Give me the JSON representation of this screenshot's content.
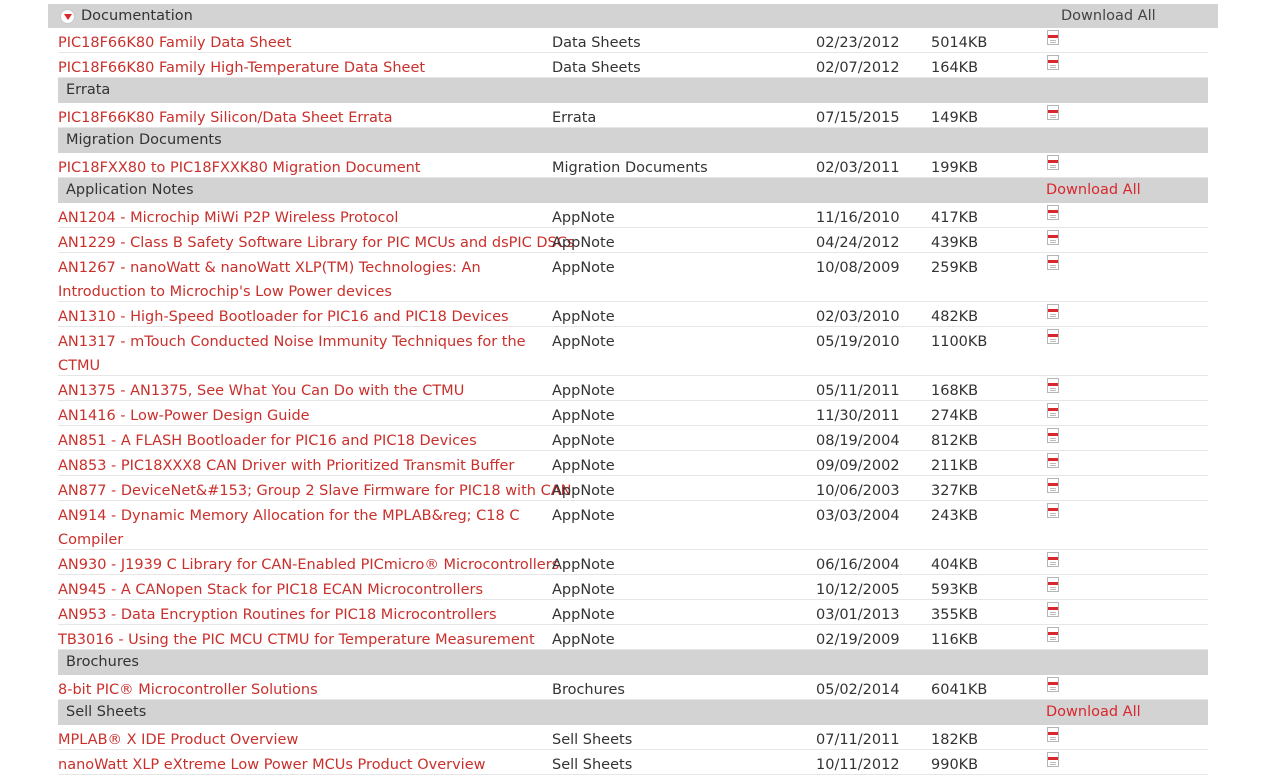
{
  "header": {
    "title": "Documentation",
    "download_all": "Download All"
  },
  "colors": {
    "link": "#c9302c",
    "accent": "#d9272e",
    "category_bg": "#d3d3d3"
  },
  "icons": {
    "row_file": "pdf-icon",
    "header_toggle": "collapse-arrow-icon"
  },
  "sections": [
    {
      "label": "",
      "download_all": "",
      "items": [
        {
          "name": "PIC18F66K80 Family Data Sheet",
          "type": "Data Sheets",
          "date": "02/23/2012",
          "size": "5014KB",
          "tall": false
        },
        {
          "name": "PIC18F66K80 Family High-Temperature Data Sheet",
          "type": "Data Sheets",
          "date": "02/07/2012",
          "size": "164KB",
          "tall": false
        }
      ]
    },
    {
      "label": "Errata",
      "download_all": "",
      "items": [
        {
          "name": "PIC18F66K80 Family Silicon/Data Sheet Errata",
          "type": "Errata",
          "date": "07/15/2015",
          "size": "149KB",
          "tall": false
        }
      ]
    },
    {
      "label": "Migration Documents",
      "download_all": "",
      "items": [
        {
          "name": "PIC18FXX80 to PIC18FXXK80 Migration Document",
          "type": "Migration Documents",
          "date": "02/03/2011",
          "size": "199KB",
          "tall": false
        }
      ]
    },
    {
      "label": "Application Notes",
      "download_all": "Download All",
      "items": [
        {
          "name": "AN1204 - Microchip MiWi P2P Wireless Protocol",
          "type": "AppNote",
          "date": "11/16/2010",
          "size": "417KB",
          "tall": false
        },
        {
          "name": "AN1229 - Class B Safety Software Library for PIC MCUs and dsPIC DSCs",
          "type": "AppNote",
          "date": "04/24/2012",
          "size": "439KB",
          "tall": false
        },
        {
          "name": "AN1267 - nanoWatt & nanoWatt XLP(TM) Technologies: An Introduction to Microchip's Low Power devices",
          "type": "AppNote",
          "date": "10/08/2009",
          "size": "259KB",
          "tall": true
        },
        {
          "name": "AN1310 - High-Speed Bootloader for PIC16 and PIC18 Devices",
          "type": "AppNote",
          "date": "02/03/2010",
          "size": "482KB",
          "tall": false
        },
        {
          "name": "AN1317 - mTouch Conducted Noise Immunity Techniques for the CTMU",
          "type": "AppNote",
          "date": "05/19/2010",
          "size": "1100KB",
          "tall": true
        },
        {
          "name": "AN1375 - AN1375, See What You Can Do with the CTMU",
          "type": "AppNote",
          "date": "05/11/2011",
          "size": "168KB",
          "tall": false
        },
        {
          "name": "AN1416 - Low-Power Design Guide",
          "type": "AppNote",
          "date": "11/30/2011",
          "size": "274KB",
          "tall": false
        },
        {
          "name": "AN851 - A FLASH Bootloader for PIC16 and PIC18 Devices",
          "type": "AppNote",
          "date": "08/19/2004",
          "size": "812KB",
          "tall": false
        },
        {
          "name": "AN853 - PIC18XXX8 CAN Driver with Prioritized Transmit Buffer",
          "type": "AppNote",
          "date": "09/09/2002",
          "size": "211KB",
          "tall": false
        },
        {
          "name": "AN877 - DeviceNet&#153; Group 2 Slave Firmware for PIC18 with CAN",
          "type": "AppNote",
          "date": "10/06/2003",
          "size": "327KB",
          "tall": false
        },
        {
          "name": "AN914 - Dynamic Memory Allocation for the MPLAB&reg; C18 C Compiler",
          "type": "AppNote",
          "date": "03/03/2004",
          "size": "243KB",
          "tall": true
        },
        {
          "name": "AN930 - J1939 C Library for CAN-Enabled PICmicro® Microcontrollers",
          "type": "AppNote",
          "date": "06/16/2004",
          "size": "404KB",
          "tall": false
        },
        {
          "name": "AN945 - A CANopen Stack for PIC18 ECAN Microcontrollers",
          "type": "AppNote",
          "date": "10/12/2005",
          "size": "593KB",
          "tall": false
        },
        {
          "name": "AN953 - Data Encryption Routines for PIC18 Microcontrollers",
          "type": "AppNote",
          "date": "03/01/2013",
          "size": "355KB",
          "tall": false
        },
        {
          "name": "TB3016 - Using the PIC MCU CTMU for Temperature Measurement",
          "type": "AppNote",
          "date": "02/19/2009",
          "size": "116KB",
          "tall": false
        }
      ]
    },
    {
      "label": "Brochures",
      "download_all": "",
      "items": [
        {
          "name": "8-bit PIC® Microcontroller Solutions",
          "type": "Brochures",
          "date": "05/02/2014",
          "size": "6041KB",
          "tall": false
        }
      ]
    },
    {
      "label": "Sell Sheets",
      "download_all": "Download All",
      "items": [
        {
          "name": "MPLAB® X IDE Product Overview",
          "type": "Sell Sheets",
          "date": "07/11/2011",
          "size": "182KB",
          "tall": false
        },
        {
          "name": "nanoWatt XLP eXtreme Low Power MCUs Product Overview",
          "type": "Sell Sheets",
          "date": "10/11/2012",
          "size": "990KB",
          "tall": false
        }
      ]
    }
  ]
}
